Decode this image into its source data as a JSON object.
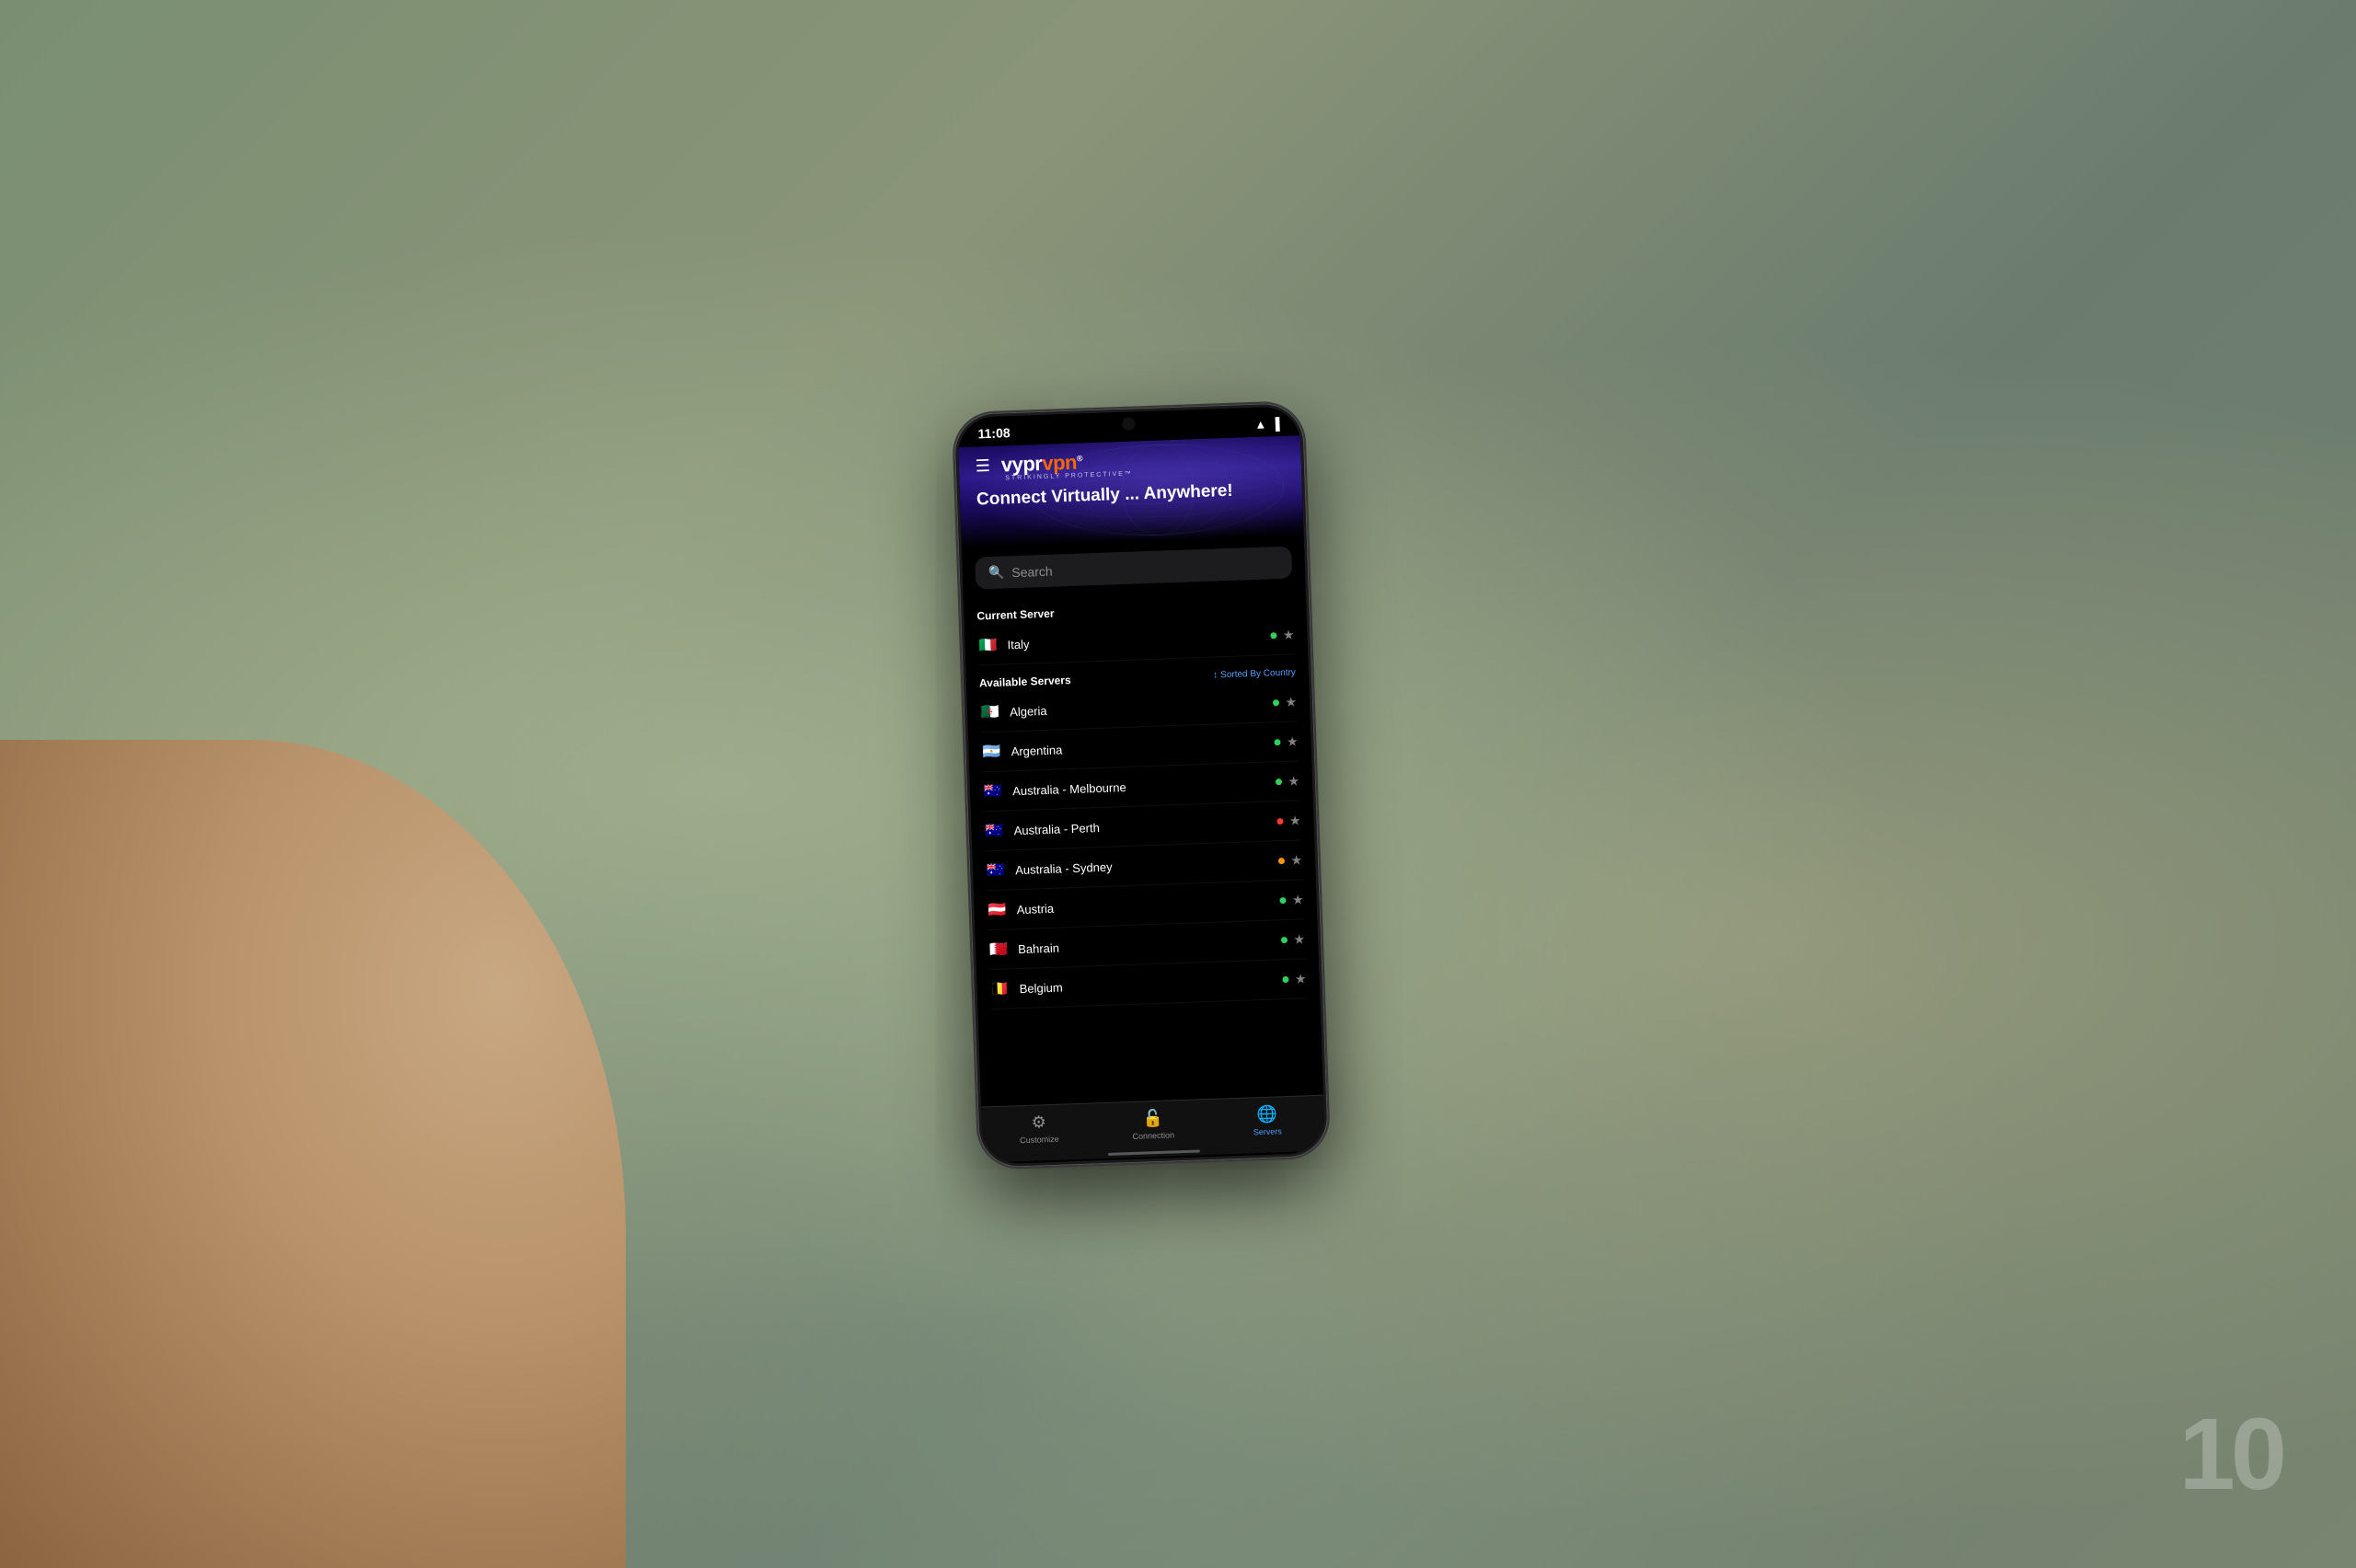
{
  "background": {
    "color": "#6b7c6e"
  },
  "watermark": {
    "text": "10"
  },
  "phone": {
    "status_bar": {
      "time": "11:08",
      "wifi_icon": "▲",
      "battery_icon": "🔋"
    },
    "header": {
      "menu_icon": "☰",
      "logo_prefix": "vypr",
      "logo_suffix": "vpn",
      "logo_registered": "®",
      "tagline": "STRIKINGLY PROTECTIVE™",
      "connect_text": "Connect Virtually ... Anywhere!"
    },
    "search": {
      "placeholder": "Search",
      "icon": "🔍"
    },
    "current_server": {
      "section_label": "Current Server",
      "name": "Italy",
      "flag": "🇮🇹",
      "dot_color": "green",
      "starred": false
    },
    "available_servers": {
      "section_label": "Available Servers",
      "sort_icon": "↕",
      "sort_label": "Sorted By Country",
      "items": [
        {
          "name": "Algeria",
          "flag": "🇩🇿",
          "dot": "green"
        },
        {
          "name": "Argentina",
          "flag": "🇦🇷",
          "dot": "green"
        },
        {
          "name": "Australia - Melbourne",
          "flag": "🇦🇺",
          "dot": "green"
        },
        {
          "name": "Australia - Perth",
          "flag": "🇦🇺",
          "dot": "red"
        },
        {
          "name": "Australia - Sydney",
          "flag": "🇦🇺",
          "dot": "orange"
        },
        {
          "name": "Austria",
          "flag": "🇦🇹",
          "dot": "green"
        },
        {
          "name": "Bahrain",
          "flag": "🇧🇭",
          "dot": "green"
        },
        {
          "name": "Belgium",
          "flag": "🇧🇪",
          "dot": "green"
        }
      ]
    },
    "bottom_nav": {
      "items": [
        {
          "label": "Customize",
          "icon": "⚙",
          "active": false
        },
        {
          "label": "Connection",
          "icon": "🔓",
          "active": false
        },
        {
          "label": "Servers",
          "icon": "🌐",
          "active": true
        }
      ]
    }
  }
}
